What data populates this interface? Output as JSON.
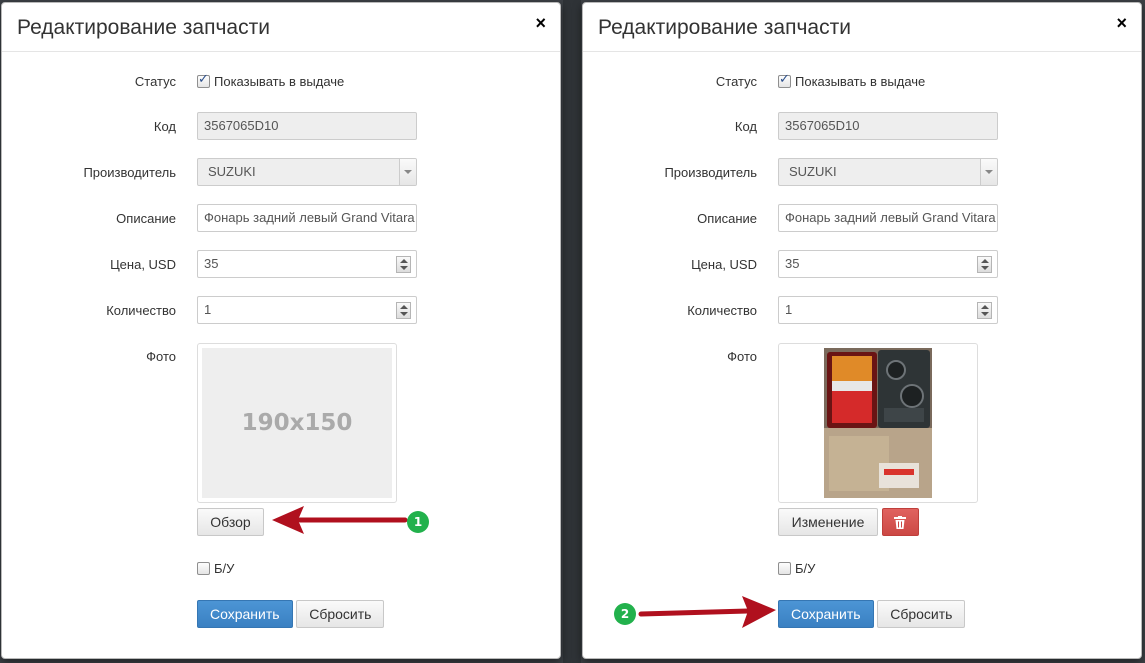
{
  "left_dialog": {
    "title": "Редактирование запчасти",
    "close_icon": "×",
    "status": {
      "label": "Статус",
      "checkbox_label": "Показывать в выдаче",
      "checked": true
    },
    "code": {
      "label": "Код",
      "value": "3567065D10"
    },
    "manufacturer": {
      "label": "Производитель",
      "value": "SUZUKI"
    },
    "description": {
      "label": "Описание",
      "value": "Фонарь задний левый Grand Vitara"
    },
    "price": {
      "label": "Цена, USD",
      "value": "35"
    },
    "quantity": {
      "label": "Количество",
      "value": "1"
    },
    "photo": {
      "label": "Фото",
      "placeholder": "190x150"
    },
    "browse_button": "Обзор",
    "used": {
      "label": "Б/У",
      "checked": false
    },
    "save_button": "Сохранить",
    "reset_button": "Сбросить",
    "step_badge": "1"
  },
  "right_dialog": {
    "title": "Редактирование запчасти",
    "close_icon": "×",
    "status": {
      "label": "Статус",
      "checkbox_label": "Показывать в выдаче",
      "checked": true
    },
    "code": {
      "label": "Код",
      "value": "3567065D10"
    },
    "manufacturer": {
      "label": "Производитель",
      "value": "SUZUKI"
    },
    "description": {
      "label": "Описание",
      "value": "Фонарь задний левый Grand Vitara"
    },
    "price": {
      "label": "Цена, USD",
      "value": "35"
    },
    "quantity": {
      "label": "Количество",
      "value": "1"
    },
    "photo": {
      "label": "Фото"
    },
    "change_button": "Изменение",
    "delete_icon": "trash-icon",
    "used": {
      "label": "Б/У",
      "checked": false
    },
    "save_button": "Сохранить",
    "reset_button": "Сбросить",
    "step_badge": "2"
  },
  "colors": {
    "primary": "#428bca",
    "danger": "#d9534f",
    "badge": "#22b14c",
    "arrow": "#b0101e"
  }
}
